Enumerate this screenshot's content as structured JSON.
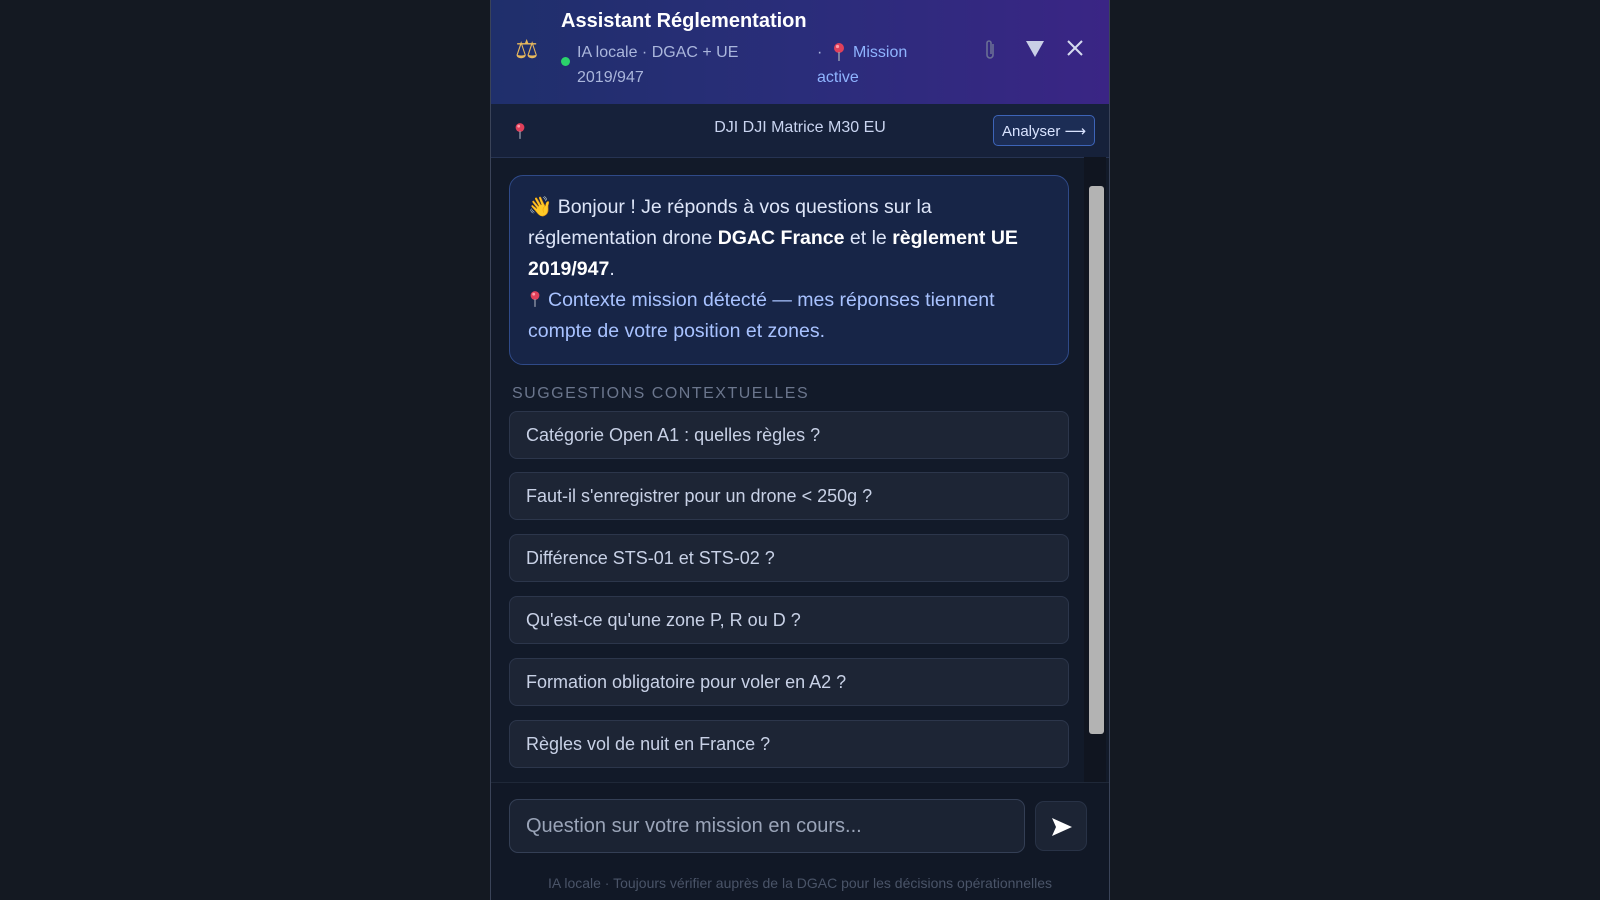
{
  "header": {
    "title": "Assistant Réglementation",
    "icon": "balance-scale-icon",
    "subtitle": "IA locale · DGAC + UE 2019/947",
    "separator": "·",
    "mission_status": "Mission active",
    "status_color": "#2bd36b"
  },
  "context_bar": {
    "drone": "DJI DJI Matrice M30 EU",
    "analyze_button": "Analyser ⟶"
  },
  "welcome": {
    "greeting": "Bonjour ! Je réponds à vos questions sur la réglementation drone ",
    "strong1": "DGAC France",
    "middle": " et le ",
    "strong2": "règlement UE 2019/947",
    "end": ".",
    "context_line": "Contexte mission détecté — mes réponses tiennent compte de votre position et zones."
  },
  "suggestions": {
    "title": "SUGGESTIONS CONTEXTUELLES",
    "items": [
      "Catégorie Open A1 : quelles règles ?",
      "Faut-il s'enregistrer pour un drone < 250g ?",
      "Différence STS-01 et STS-02 ?",
      "Qu'est-ce qu'une zone P, R ou D ?",
      "Formation obligatoire pour voler en A2 ?",
      "Règles vol de nuit en France ?"
    ]
  },
  "input": {
    "placeholder": "Question sur votre mission en cours..."
  },
  "footer": {
    "note": "IA locale · Toujours vérifier auprès de la DGAC pour les décisions opérationnelles"
  },
  "colors": {
    "accent": "#8fb4ff",
    "pin": "#e0405a"
  }
}
